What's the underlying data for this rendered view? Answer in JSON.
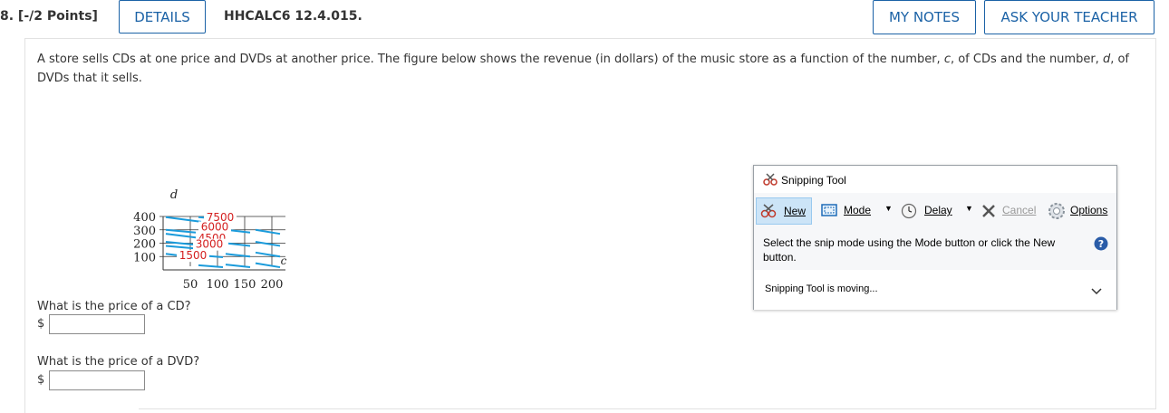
{
  "header": {
    "question_number": "8. [-/2 Points]",
    "details_label": "DETAILS",
    "code": "HHCALC6 12.4.015.",
    "my_notes_label": "MY NOTES",
    "ask_teacher_label": "ASK YOUR TEACHER"
  },
  "problem": {
    "text_before_c": "A store sells CDs at one price and DVDs at another price. The figure below shows the revenue (in dollars) of the music store as a function of the number, ",
    "var_c": "c",
    "text_middle": ", of CDs and the number, ",
    "var_d": "d",
    "text_after": ", of DVDs that it sells."
  },
  "questions": [
    {
      "text": "What is the price of a CD?",
      "prefix": "$",
      "value": ""
    },
    {
      "text": "What is the price of a DVD?",
      "prefix": "$",
      "value": ""
    }
  ],
  "chart_data": {
    "type": "contour",
    "xlabel": "c",
    "ylabel": "d",
    "xlim": [
      0,
      250
    ],
    "ylim": [
      0,
      400
    ],
    "x_ticks": [
      "50",
      "100",
      "150",
      "200"
    ],
    "y_ticks": [
      "100",
      "200",
      "300",
      "400"
    ],
    "grid": true,
    "contour_color": "#1a9bdb",
    "contour_labels": [
      "1500",
      "3000",
      "4500",
      "6000",
      "7500"
    ]
  },
  "snipping_tool": {
    "title": "Snipping Tool",
    "new_label": "New",
    "mode_label": "Mode",
    "delay_label": "Delay",
    "cancel_label": "Cancel",
    "options_label": "Options",
    "message": "Select the snip mode using the Mode button or click the New button.",
    "status": "Snipping Tool is moving..."
  }
}
